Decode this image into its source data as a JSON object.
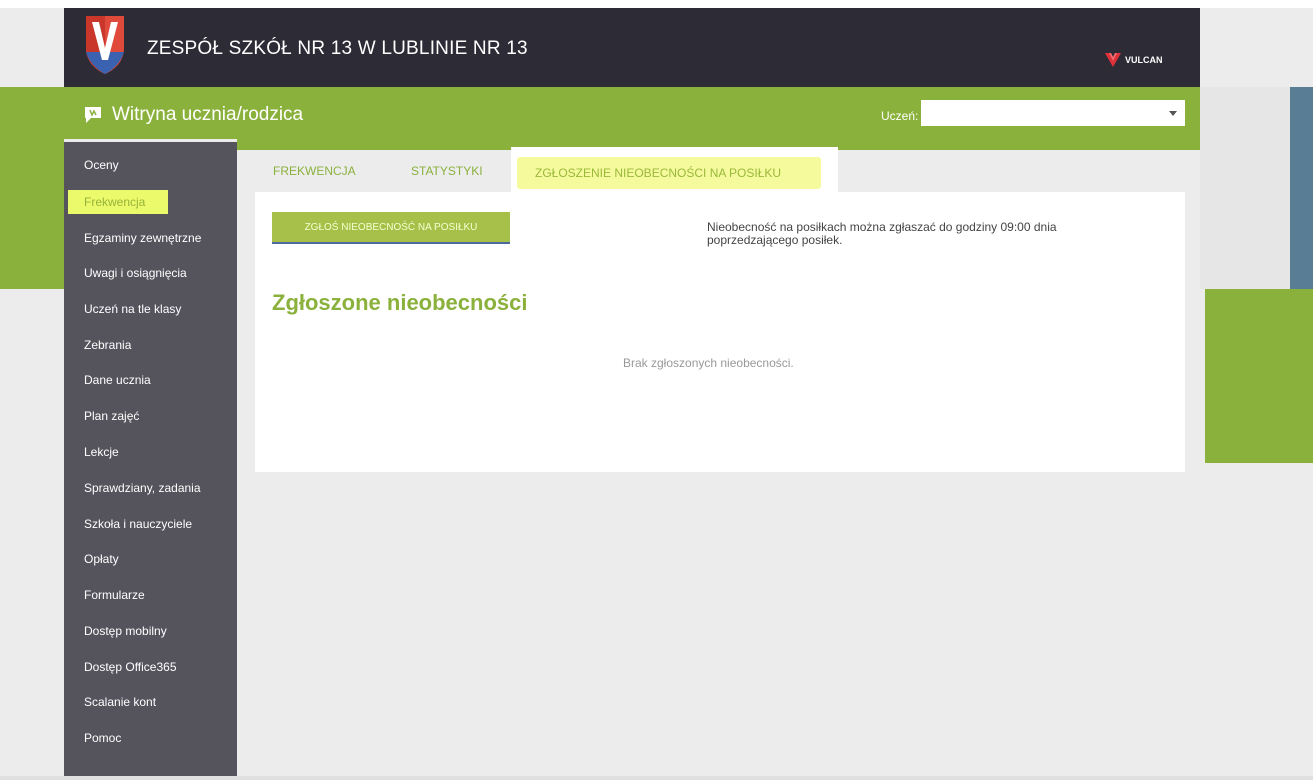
{
  "header": {
    "school_name": "ZESPÓŁ SZKÓŁ NR 13 W LUBLINIE NR 13",
    "vendor_logo_text": "VULCAN",
    "logo_letter": "V"
  },
  "subheader": {
    "title": "Witryna ucznia/rodzica",
    "student_label": "Uczeń:",
    "student_value": ""
  },
  "sidebar": {
    "items": [
      {
        "label": "Oceny"
      },
      {
        "label": "Frekwencja"
      },
      {
        "label": "Egzaminy zewnętrzne"
      },
      {
        "label": "Uwagi i osiągnięcia"
      },
      {
        "label": "Uczeń na tle klasy"
      },
      {
        "label": "Zebrania"
      },
      {
        "label": "Dane ucznia"
      },
      {
        "label": "Plan zajęć"
      },
      {
        "label": "Lekcje"
      },
      {
        "label": "Sprawdziany, zadania"
      },
      {
        "label": "Szkoła i nauczyciele"
      },
      {
        "label": "Opłaty"
      },
      {
        "label": "Formularze"
      },
      {
        "label": "Dostęp mobilny"
      },
      {
        "label": "Dostęp Office365"
      },
      {
        "label": "Scalanie kont"
      },
      {
        "label": "Pomoc"
      }
    ]
  },
  "tabs": [
    {
      "label": "FREKWENCJA"
    },
    {
      "label": "STATYSTYKI"
    },
    {
      "label": "ZGŁOSZENIE NIEOBECNOŚCI NA POSIŁKU"
    }
  ],
  "main": {
    "report_button": "ZGŁOŚ NIEOBECNOŚĆ NA POSIŁKU",
    "notice": "Nieobecność na posiłkach można zgłaszać do godziny 09:00 dnia poprzedzającego posiłek.",
    "section_title": "Zgłoszone nieobecności",
    "empty_message": "Brak zgłoszonych nieobecności."
  },
  "colors": {
    "accent_green": "#8bb13d",
    "header_dark": "#2d2c36",
    "sidebar_gray": "#55535c",
    "highlight_yellow": "#ebfa6a"
  }
}
